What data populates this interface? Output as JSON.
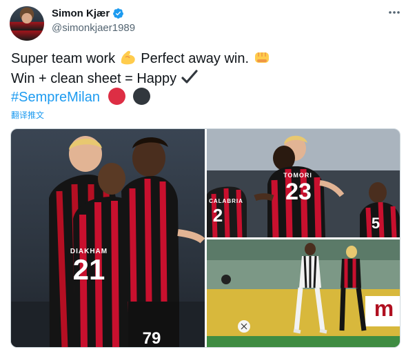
{
  "tweet": {
    "display_name": "Simon Kjær",
    "handle": "@simonkjaer1989",
    "text_line1_a": "Super team work",
    "text_line1_b": "  Perfect away win.",
    "text_line2": "Win + clean sheet = Happy",
    "hashtag": "#SempreMilan",
    "translate_link": "翻译推文"
  },
  "icons": {
    "verified": "verified-badge-icon",
    "more": "more-options-icon",
    "emoji1": "flexed-biceps-emoji",
    "emoji2": "oncoming-fist-emoji",
    "emoji3": "check-mark-emoji",
    "emoji4": "red-circle-emoji",
    "emoji5": "black-circle-emoji"
  },
  "media": {
    "photo_left": {
      "jersey_numbers": [
        "21",
        "79"
      ],
      "jersey_name": "DIAKHAM"
    },
    "photo_top_right": {
      "jersey_number": "23",
      "jersey_name": "TOMORI",
      "back_player_name": "CALABRIA",
      "back_player_number": "2",
      "right_player_number": "5"
    },
    "photo_bottom_right": {
      "board_text": "m"
    }
  },
  "colors": {
    "link": "#1d9bf0",
    "text": "#0f1419",
    "secondary": "#536471",
    "milan_red": "#c8102e"
  }
}
